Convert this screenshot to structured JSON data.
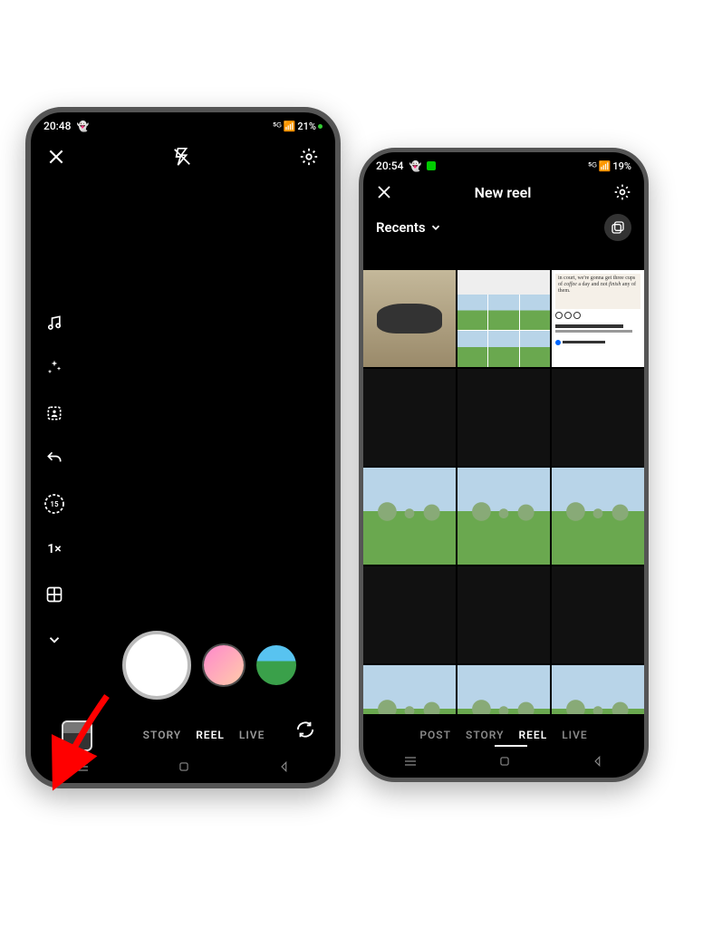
{
  "left_phone": {
    "status": {
      "time": "20:48",
      "battery": "21%"
    },
    "tools": {
      "zoom": "1×",
      "timer": "15"
    },
    "modes": {
      "story": "STORY",
      "reel": "REEL",
      "live": "LIVE"
    }
  },
  "right_phone": {
    "status": {
      "time": "20:54",
      "battery": "19%"
    },
    "title": "New reel",
    "album_dropdown": "Recents",
    "modes": {
      "post": "POST",
      "story": "STORY",
      "reel": "REEL",
      "live": "LIVE"
    }
  },
  "annotation": {
    "type": "arrow",
    "color": "#ff0000",
    "target": "gallery-button"
  }
}
